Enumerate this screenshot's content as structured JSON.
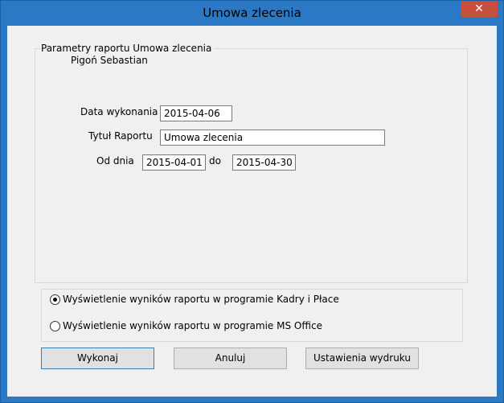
{
  "window": {
    "title": "Umowa zlecenia",
    "close_label": "✕"
  },
  "group": {
    "legend": "Parametry raportu  Umowa zlecenia",
    "subtitle": "Pigoń Sebastian"
  },
  "form": {
    "data_wykonania_label": "Data wykonania",
    "data_wykonania_value": "2015-04-06",
    "tytul_label": "Tytuł Raportu",
    "tytul_value": "Umowa zlecenia",
    "od_dnia_label": "Od dnia",
    "od_dnia_value": "2015-04-01",
    "do_label": "do",
    "do_value": "2015-04-30"
  },
  "output_options": [
    {
      "label": "Wyświetlenie wyników raportu w programie Kadry i Płace",
      "selected": true
    },
    {
      "label": "Wyświetlenie wyników raportu w programie MS Office",
      "selected": false
    }
  ],
  "buttons": {
    "execute": "Wykonaj",
    "cancel": "Anuluj",
    "print_settings": "Ustawienia wydruku"
  }
}
